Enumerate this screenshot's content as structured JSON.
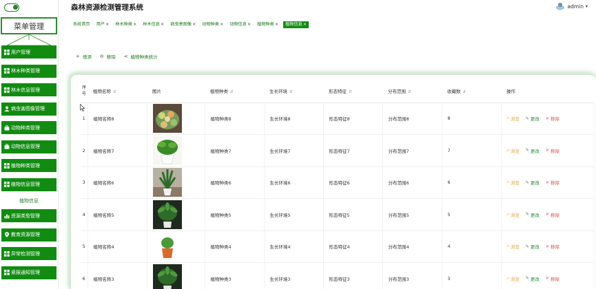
{
  "app": {
    "title": "森林资源检测管理系统",
    "user": "admin"
  },
  "sidebar": {
    "title": "菜单管理",
    "items": [
      {
        "label": "用户管理",
        "icon": "grid-icon",
        "type": "item"
      },
      {
        "label": "林木种类管理",
        "icon": "grid-icon",
        "type": "item"
      },
      {
        "label": "林木信息管理",
        "icon": "grid-icon",
        "type": "item"
      },
      {
        "label": "病虫害图像管理",
        "icon": "user-icon",
        "type": "item"
      },
      {
        "label": "动物种类管理",
        "icon": "briefcase-icon",
        "type": "item"
      },
      {
        "label": "动物信息管理",
        "icon": "briefcase-icon",
        "type": "item"
      },
      {
        "label": "植物种类管理",
        "icon": "grid-icon",
        "type": "item"
      },
      {
        "label": "植物信息管理",
        "icon": "grid-icon",
        "type": "item"
      },
      {
        "label": "植物信息",
        "icon": "",
        "type": "sub"
      },
      {
        "label": "资源类型管理",
        "icon": "bar-chart-icon",
        "type": "item"
      },
      {
        "label": "教育资源管理",
        "icon": "pin-icon",
        "type": "item"
      },
      {
        "label": "异常检测管理",
        "icon": "grid-icon",
        "type": "item"
      },
      {
        "label": "紧报通知管理",
        "icon": "grid-icon",
        "type": "item"
      }
    ]
  },
  "tabs": [
    {
      "label": "系统首页",
      "closable": false,
      "active": false
    },
    {
      "label": "用户",
      "closable": true,
      "active": false
    },
    {
      "label": "林木种类",
      "closable": true,
      "active": false
    },
    {
      "label": "林木信息",
      "closable": true,
      "active": false
    },
    {
      "label": "病虫害图像",
      "closable": true,
      "active": false
    },
    {
      "label": "动物种类",
      "closable": true,
      "active": false
    },
    {
      "label": "动物信息",
      "closable": true,
      "active": false
    },
    {
      "label": "植物种类",
      "closable": true,
      "active": false
    },
    {
      "label": "植物信息",
      "closable": true,
      "active": true
    }
  ],
  "actions": [
    {
      "label": "增添",
      "icon": "plus-icon"
    },
    {
      "label": "移除",
      "icon": "minus-circle-icon"
    },
    {
      "label": "植物种类统计",
      "icon": "share-icon"
    }
  ],
  "table": {
    "headers": {
      "index": "序号",
      "name": "植物名称",
      "image": "图片",
      "type": "植物种类",
      "env": "生长环境",
      "feature": "形态特征",
      "range": "分布范围",
      "favorites": "收藏数",
      "ops": "操作"
    },
    "op_labels": {
      "view": "浏览",
      "edit": "更改",
      "del": "移除"
    },
    "rows": [
      {
        "index": "1",
        "name": "植物名称8",
        "type": "植物种类8",
        "env": "生长环境8",
        "feature": "形态特征8",
        "range": "分布范围8",
        "favorites": "8",
        "image": "succulent-plant-icon"
      },
      {
        "index": "2",
        "name": "植物名称7",
        "type": "植物种类7",
        "env": "生长环境7",
        "feature": "形态特征7",
        "range": "分布范围7",
        "favorites": "7",
        "image": "potted-green-plant-icon"
      },
      {
        "index": "3",
        "name": "植物名称6",
        "type": "植物种类6",
        "env": "生长环境6",
        "feature": "形态特征6",
        "range": "分布范围6",
        "favorites": "6",
        "image": "tall-potted-plant-icon"
      },
      {
        "index": "4",
        "name": "植物名称5",
        "type": "植物种类5",
        "env": "生长环境5",
        "feature": "形态特征5",
        "range": "分布范围5",
        "favorites": "5",
        "image": "dark-leaf-plant-icon"
      },
      {
        "index": "5",
        "name": "植物名称4",
        "type": "植物种类4",
        "env": "生长环境4",
        "feature": "形态特征4",
        "range": "分布范围4",
        "favorites": "4",
        "image": "small-pot-plant-icon"
      },
      {
        "index": "6",
        "name": "植物名称3",
        "type": "植物种类3",
        "env": "生长环境3",
        "feature": "形态特征3",
        "range": "分布范围3",
        "favorites": "3",
        "image": "dark-leaf-plant-icon"
      }
    ]
  },
  "colors": {
    "primary": "#118c11",
    "view": "#e6a23c",
    "edit": "#2e8b2e",
    "delete": "#d9534f"
  }
}
